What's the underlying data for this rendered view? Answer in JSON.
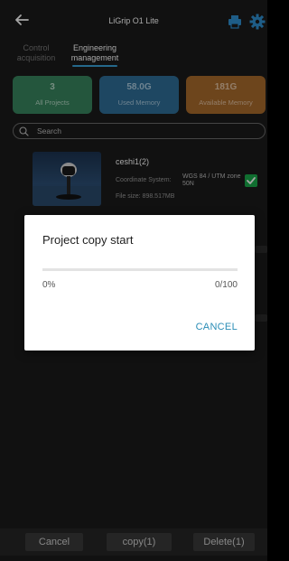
{
  "header": {
    "title": "LiGrip O1 Lite",
    "back_icon": "back-arrow-icon",
    "printer_icon": "printer-icon",
    "settings_icon": "gear-icon"
  },
  "tabs": [
    {
      "label": "Control acquisition",
      "active": false
    },
    {
      "label": "Engineering management",
      "active": true
    }
  ],
  "stats": [
    {
      "value": "3",
      "label": "All Projects",
      "color": "#38855f"
    },
    {
      "value": "58.0G",
      "label": "Used Memory",
      "color": "#2f6e97"
    },
    {
      "value": "181G",
      "label": "Available Memory",
      "color": "#a86a2c"
    }
  ],
  "search": {
    "placeholder": "Search"
  },
  "project": {
    "name": "ceshi1(2)",
    "coord_label": "Coordinate System:",
    "coord_value": "WGS 84 / UTM zone 50N",
    "file_size": "File size:  898.517MB",
    "selected": true
  },
  "dialog": {
    "title": "Project copy start",
    "progress_percent_text": "0%",
    "progress_count_text": "0/100",
    "progress_fraction": 0,
    "cancel_label": "CANCEL",
    "accent": "#2a8db6"
  },
  "bottom_bar": {
    "cancel_label": "Cancel",
    "copy_label": "copy(1)",
    "delete_label": "Delete(1)"
  }
}
